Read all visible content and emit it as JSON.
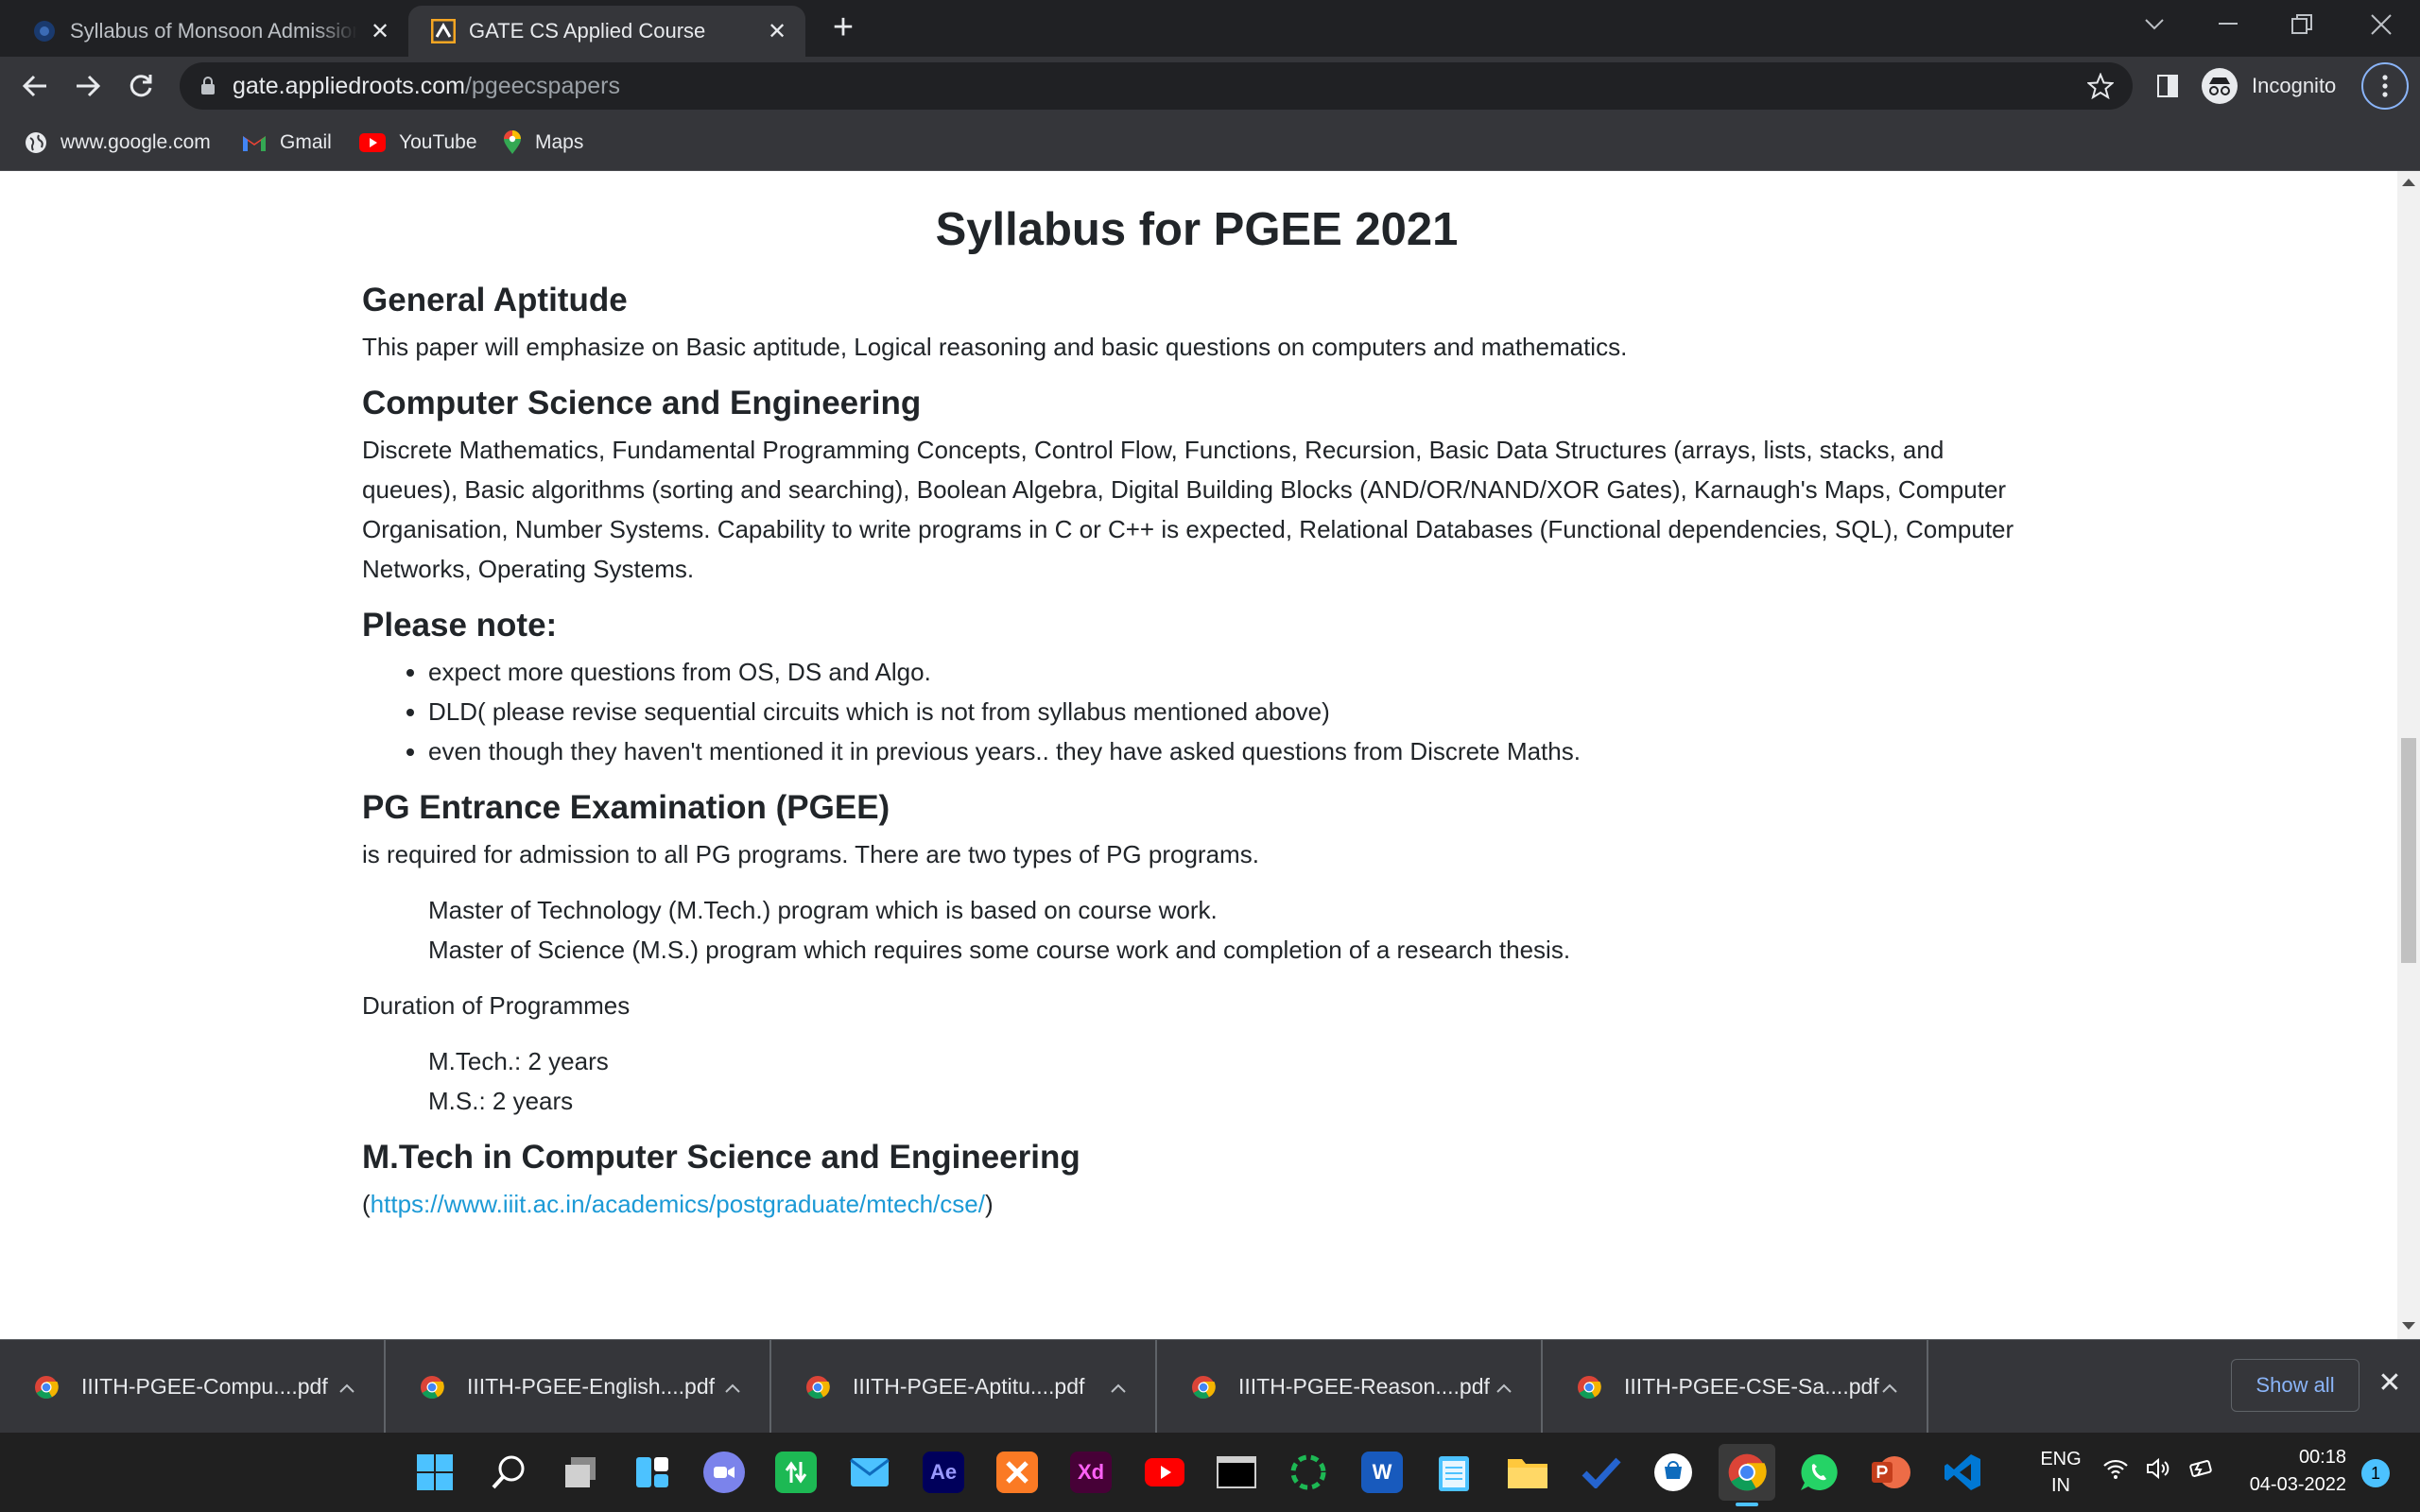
{
  "browser": {
    "tabs": [
      {
        "title": "Syllabus of Monsoon Admissions",
        "active": false
      },
      {
        "title": "GATE CS Applied Course",
        "active": true
      }
    ],
    "url": {
      "host": "gate.appliedroots.com",
      "path": "/pgeecspapers"
    },
    "profile_label": "Incognito",
    "bookmarks": [
      "www.google.com",
      "Gmail",
      "YouTube",
      "Maps"
    ]
  },
  "page": {
    "title": "Syllabus for PGEE 2021",
    "sections": {
      "aptitude": {
        "heading": "General Aptitude",
        "text": "This paper will emphasize on Basic aptitude, Logical reasoning and basic questions on computers and mathematics."
      },
      "cse": {
        "heading": "Computer Science and Engineering",
        "text": "Discrete Mathematics, Fundamental Programming Concepts, Control Flow, Functions, Recursion, Basic Data Structures (arrays, lists, stacks, and queues), Basic algorithms (sorting and searching), Boolean Algebra, Digital Building Blocks (AND/OR/NAND/XOR Gates), Karnaugh's Maps, Computer Organisation, Number Systems. Capability to write programs in C or C++ is expected, Relational Databases (Functional dependencies, SQL), Computer Networks, Operating Systems."
      },
      "note": {
        "heading": "Please note:",
        "items": [
          "expect more questions from OS, DS and Algo.",
          "DLD( please revise sequential circuits which is not from syllabus mentioned above)",
          "even though they haven't mentioned it in previous years.. they have asked questions from Discrete Maths."
        ]
      },
      "pgee": {
        "heading": "PG Entrance Examination (PGEE)",
        "text": "is required for admission to all PG programs. There are two types of PG programs.",
        "programs": [
          "Master of Technology (M.Tech.) program which is based on course work.",
          "Master of Science (M.S.) program which requires some course work and completion of a research thesis."
        ],
        "duration_label": "Duration of Programmes",
        "durations": [
          "M.Tech.: 2 years",
          "M.S.: 2 years"
        ]
      },
      "mtech": {
        "heading": "M.Tech in Computer Science and Engineering",
        "link_open": "(",
        "link": "https://www.iiit.ac.in/academics/postgraduate/mtech/cse/",
        "link_close": ")"
      }
    }
  },
  "downloads": {
    "files": [
      "IIITH-PGEE-Compu....pdf",
      "IIITH-PGEE-English....pdf",
      "IIITH-PGEE-Aptitu....pdf",
      "IIITH-PGEE-Reason....pdf",
      "IIITH-PGEE-CSE-Sa....pdf"
    ],
    "show_all_label": "Show all"
  },
  "taskbar": {
    "apps": [
      "start-icon",
      "search-icon",
      "task-view-icon",
      "widgets-icon",
      "teams-chat-icon",
      "file-transfer-icon",
      "mail-icon",
      "after-effects-icon",
      "xampp-icon",
      "adobe-xd-icon",
      "youtube-icon",
      "terminal-icon",
      "loading-app-icon",
      "word-icon",
      "notepad-icon",
      "file-explorer-icon",
      "todo-icon",
      "store-icon",
      "chrome-icon",
      "whatsapp-icon",
      "powerpoint-icon",
      "vscode-icon"
    ],
    "app_glyphs": {
      "after-effects-icon": "Ae",
      "adobe-xd-icon": "Xd",
      "word-icon": "W"
    },
    "language": [
      "ENG",
      "IN"
    ],
    "time": "00:18",
    "date": "04-03-2022",
    "notification_count": "1"
  },
  "colors": {
    "link": "#1c9ad6",
    "chrome_dark": "#202124",
    "chrome_toolbar": "#35363a",
    "accent": "#8ab4f8"
  }
}
